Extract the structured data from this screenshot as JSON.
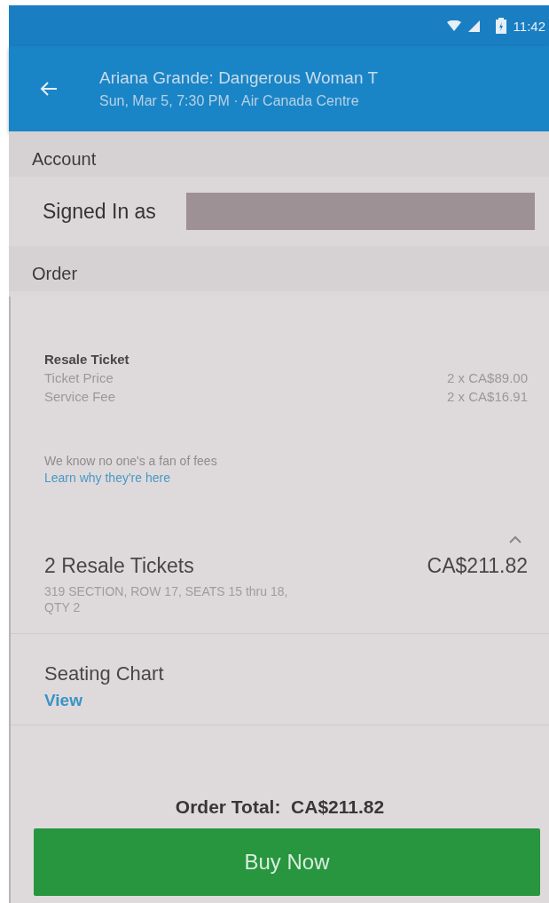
{
  "status_bar": {
    "time": "11:42"
  },
  "app_bar": {
    "title": "Ariana Grande: Dangerous Woman T",
    "subtitle": "Sun, Mar 5, 7:30 PM · Air Canada Centre"
  },
  "account": {
    "heading": "Account",
    "label": "Signed In as",
    "redacted": true
  },
  "order": {
    "heading": "Order",
    "group_title": "Resale Ticket",
    "lines": [
      {
        "label": "Ticket Price",
        "value": "2 x CA$89.00"
      },
      {
        "label": "Service Fee",
        "value": "2 x CA$16.91"
      }
    ],
    "fee_note": "We know no one's a fan of fees",
    "fee_link": "Learn why they're here",
    "expanded": true,
    "summary_title": "2 Resale Tickets",
    "summary_price": "CA$211.82",
    "summary_detail": "319 SECTION, ROW 17, SEATS 15 thru 18, QTY 2",
    "seating_label": "Seating Chart",
    "seating_link": "View"
  },
  "total": {
    "label": "Order Total:",
    "value": "CA$211.82"
  },
  "buy_button": "Buy Now"
}
